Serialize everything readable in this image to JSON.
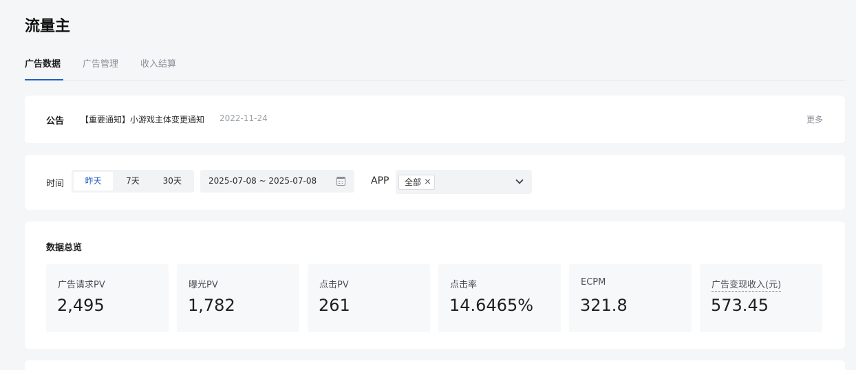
{
  "page": {
    "title": "流量主"
  },
  "tabs": [
    {
      "label": "广告数据",
      "active": true
    },
    {
      "label": "广告管理",
      "active": false
    },
    {
      "label": "收入结算",
      "active": false
    }
  ],
  "notice": {
    "label": "公告",
    "text": "【重要通知】小游戏主体变更通知",
    "date": "2022-11-24",
    "more": "更多"
  },
  "filter": {
    "time_label": "时间",
    "ranges": [
      {
        "label": "昨天",
        "active": true
      },
      {
        "label": "7天",
        "active": false
      },
      {
        "label": "30天",
        "active": false
      }
    ],
    "date_range": "2025-07-08 ~ 2025-07-08",
    "app_label": "APP",
    "app_selected": "全部",
    "tag_close": "×"
  },
  "overview": {
    "title": "数据总览",
    "metrics": [
      {
        "label": "广告请求PV",
        "value": "2,495"
      },
      {
        "label": "曝光PV",
        "value": "1,782"
      },
      {
        "label": "点击PV",
        "value": "261"
      },
      {
        "label": "点击率",
        "value": "14.6465%"
      },
      {
        "label": "ECPM",
        "value": "321.8"
      },
      {
        "label": "广告变现收入(元)",
        "value": "573.45"
      }
    ]
  },
  "colors": {
    "accent": "#1f5fbf",
    "background": "#f5f6f7",
    "card": "#ffffff"
  }
}
